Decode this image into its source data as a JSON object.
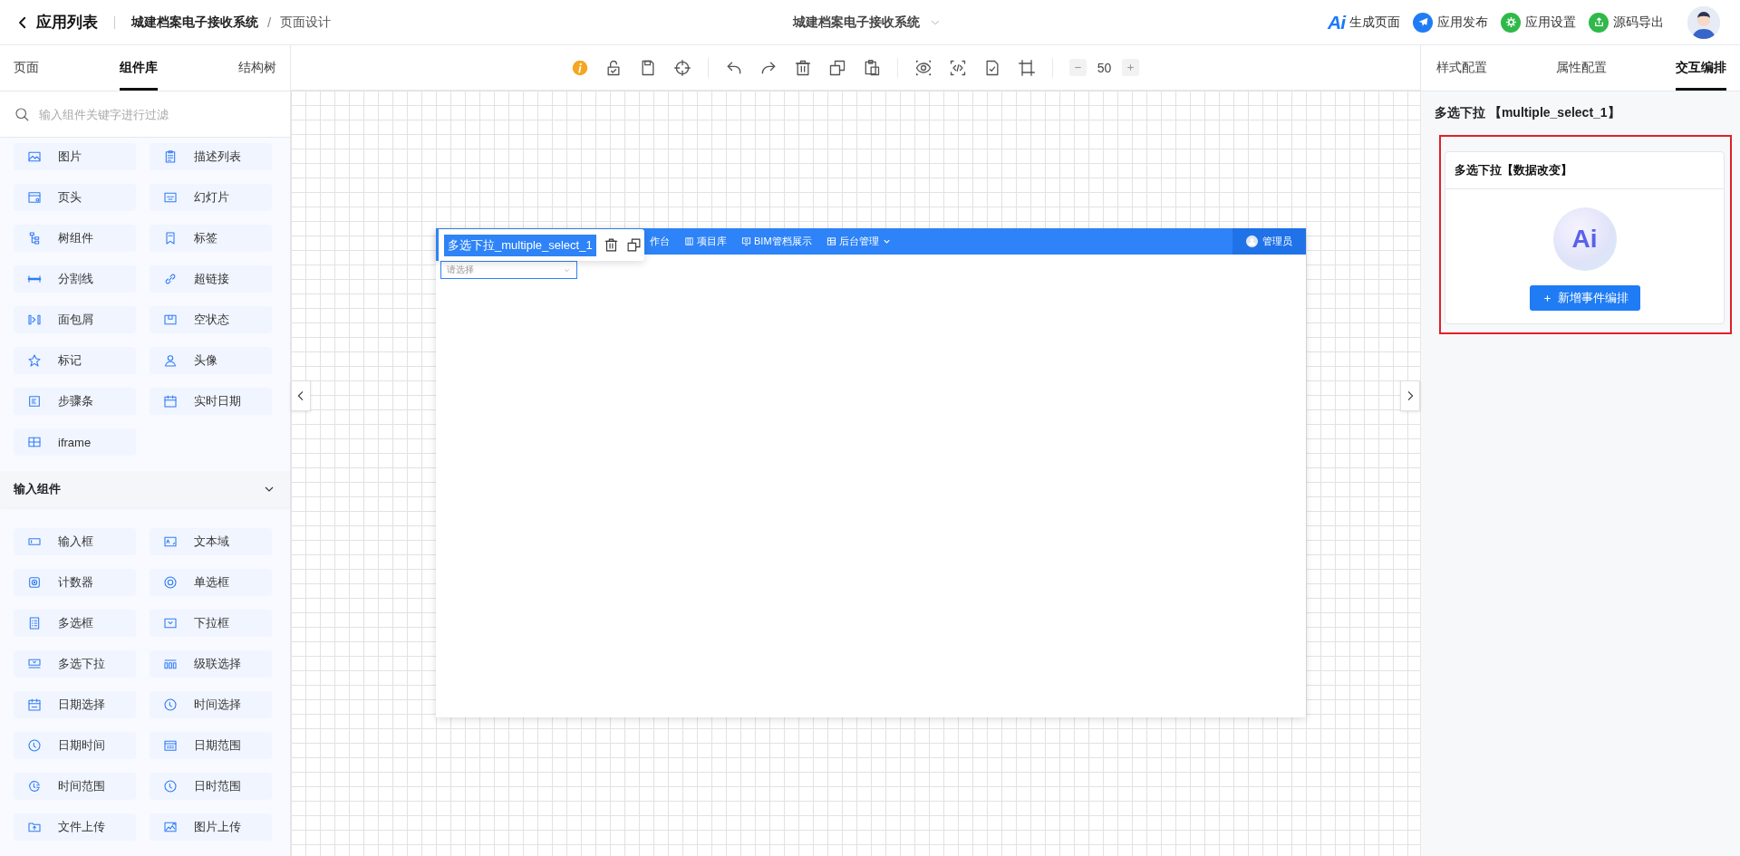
{
  "topbar": {
    "back_label": "应用列表",
    "app_name": "城建档案电子接收系统",
    "separator": "/",
    "page_name": "页面设计",
    "app_switcher": "城建档案电子接收系统",
    "actions": [
      {
        "kind": "ai",
        "badge": "Ai",
        "label": "生成页面"
      },
      {
        "kind": "publish",
        "label": "应用发布"
      },
      {
        "kind": "settings",
        "label": "应用设置"
      },
      {
        "kind": "export",
        "label": "源码导出"
      }
    ]
  },
  "left_tabs": [
    {
      "label": "页面",
      "selected": false
    },
    {
      "label": "组件库",
      "selected": true
    },
    {
      "label": "结构树",
      "selected": false
    }
  ],
  "search": {
    "placeholder": "输入组件关键字进行过滤"
  },
  "component_groups": [
    {
      "items": [
        "图片",
        "描述列表",
        "页头",
        "幻灯片",
        "树组件",
        "标签",
        "分割线",
        "超链接",
        "面包屑",
        "空状态",
        "标记",
        "头像",
        "步骤条",
        "实时日期",
        "iframe"
      ]
    },
    {
      "title": "输入组件",
      "expanded": true,
      "items": [
        "输入框",
        "文本域",
        "计数器",
        "单选框",
        "多选框",
        "下拉框",
        "多选下拉",
        "级联选择",
        "日期选择",
        "时间选择",
        "日期时间",
        "日期范围",
        "时间范围",
        "日时范围",
        "文件上传",
        "图片上传"
      ]
    }
  ],
  "toolbar": {
    "zoom": "50"
  },
  "canvas": {
    "selected_component": "多选下拉_multiple_select_1",
    "nav": [
      {
        "label": "作台",
        "kind": "link"
      },
      {
        "label": "项目库",
        "kind": "link"
      },
      {
        "label": "BIM管档展示",
        "kind": "link"
      },
      {
        "label": "后台管理",
        "kind": "menu"
      }
    ],
    "user": "管理员",
    "select_placeholder": "请选择"
  },
  "right_tabs": [
    {
      "label": "样式配置",
      "selected": false
    },
    {
      "label": "属性配置",
      "selected": false
    },
    {
      "label": "交互编排",
      "selected": true
    }
  ],
  "component_title": "多选下拉 【multiple_select_1】",
  "event_card": {
    "title": "多选下拉【数据改变】",
    "badge": "Ai",
    "button": "新增事件编排",
    "highlighted": true
  }
}
